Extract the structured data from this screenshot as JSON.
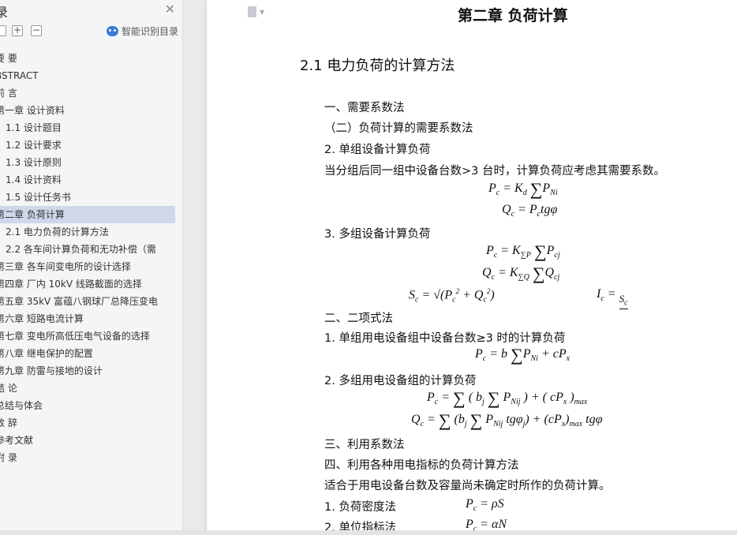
{
  "sidebar": {
    "title": "录",
    "close_icon": "close-icon",
    "tools": {
      "expand": "+",
      "collapse": "−"
    },
    "smart_label": "智能识别目录",
    "items": [
      {
        "label": "要   要",
        "level": 1
      },
      {
        "label": "BSTRACT",
        "level": 1
      },
      {
        "label": "前   言",
        "level": 1
      },
      {
        "label": "第一章  设计资料",
        "level": 1
      },
      {
        "label": "1.1 设计题目",
        "level": 2
      },
      {
        "label": "1.2 设计要求",
        "level": 2
      },
      {
        "label": "1.3 设计原则",
        "level": 2
      },
      {
        "label": "1.4 设计资料",
        "level": 2
      },
      {
        "label": "1.5 设计任务书",
        "level": 2
      },
      {
        "label": "第二章  负荷计算",
        "level": 1,
        "selected": true
      },
      {
        "label": "2.1 电力负荷的计算方法",
        "level": 2
      },
      {
        "label": "2.2  各车间计算负荷和无功补偿（需",
        "level": 2
      },
      {
        "label": "第三章  各车间变电所的设计选择",
        "level": 1
      },
      {
        "label": "第四章  厂内 10kV 线路截面的选择",
        "level": 1
      },
      {
        "label": "第五章  35kV 富蕴八钢球厂总降压变电",
        "level": 1
      },
      {
        "label": "第六章  短路电流计算",
        "level": 1
      },
      {
        "label": "第七章  变电所高低压电气设备的选择",
        "level": 1
      },
      {
        "label": "第八章  继电保护的配置",
        "level": 1
      },
      {
        "label": "第九章  防雷与接地的设计",
        "level": 1
      },
      {
        "label": "结   论",
        "level": 1
      },
      {
        "label": "总结与体会",
        "level": 1
      },
      {
        "label": "致   辞",
        "level": 1
      },
      {
        "label": "参考文献",
        "level": 1
      },
      {
        "label": "附   录",
        "level": 1
      }
    ]
  },
  "document": {
    "chapter_title": "第二章  负荷计算",
    "section_title": "2.1 电力负荷的计算方法",
    "lines": {
      "l1": "一、需要系数法",
      "l2": "（二）负荷计算的需要系数法",
      "l3": "2.  单组设备计算负荷",
      "l4": "当分组后同一组中设备台数>3 台时，计算负荷应考虑其需要系数。",
      "l5": "3.  多组设备计算负荷",
      "l6": "二、二项式法",
      "l7": "1.  单组用电设备组中设备台数≥3 时的计算负荷",
      "l8": "2.  多组用电设备组的计算负荷",
      "l9": "三、利用系数法",
      "l10": "四、利用各种用电指标的负荷计算方法",
      "l11": "适合于用电设备台数及容量尚未确定时所作的负荷计算。",
      "l12": "1.  负荷密度法",
      "l13": "2.  单位指标法"
    }
  }
}
